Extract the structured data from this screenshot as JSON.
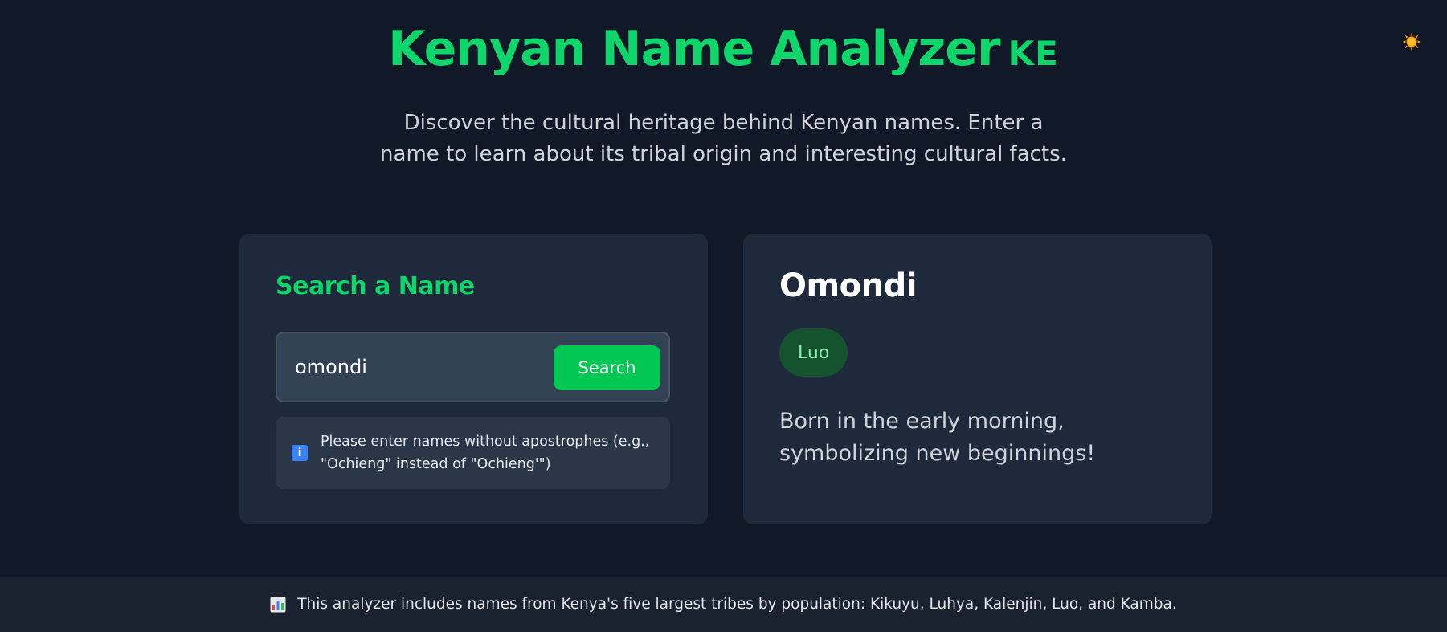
{
  "header": {
    "title": "Kenyan Name Analyzer",
    "flag_text": "KE",
    "subtitle": "Discover the cultural heritage behind Kenyan names. Enter a name to learn about its tribal origin and interesting cultural facts."
  },
  "theme_toggle": {
    "icon": "sun-icon"
  },
  "search": {
    "title": "Search a Name",
    "input_value": "omondi",
    "button_label": "Search",
    "notice": "Please enter names without apostrophes (e.g., \"Ochieng\" instead of \"Ochieng'\")",
    "notice_icon": "info-icon"
  },
  "result": {
    "name": "Omondi",
    "tribe": "Luo",
    "fact": "Born in the early morning, symbolizing new beginnings!"
  },
  "footer": {
    "icon": "bar-chart-icon",
    "text": "This analyzer includes names from Kenya's five largest tribes by population: Kikuyu, Luhya, Kalenjin, Luo, and Kamba."
  },
  "colors": {
    "background": "#111827",
    "card": "#1e293b",
    "accent": "#0fd66b",
    "button": "#00c853",
    "badge_bg": "#14532d",
    "badge_text": "#86efac"
  }
}
